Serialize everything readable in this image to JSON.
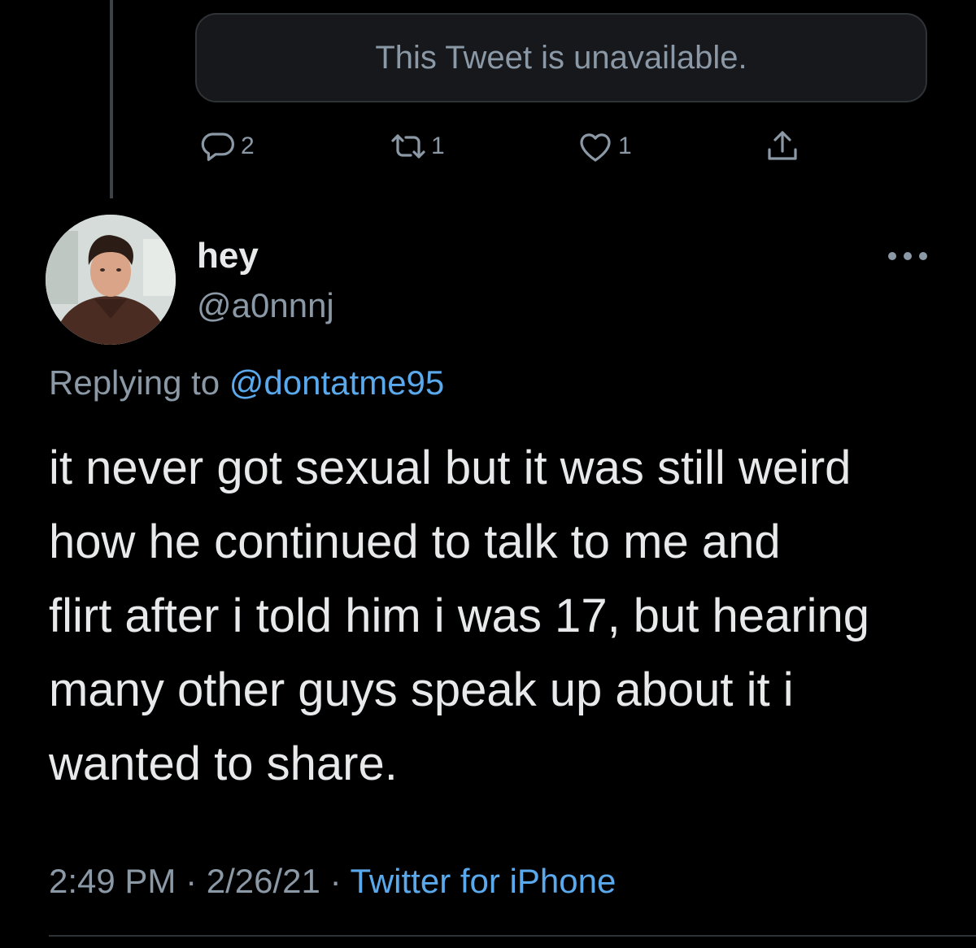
{
  "quoted": {
    "unavailable_text": "This Tweet is unavailable.",
    "actions": {
      "reply_count": "2",
      "retweet_count": "1",
      "like_count": "1"
    }
  },
  "tweet": {
    "display_name": "hey",
    "handle": "@a0nnnj",
    "replying_prefix": "Replying to",
    "replying_to": "@dontatme95",
    "text_lines": [
      "it never got sexual but it was still weird",
      "how he continued to talk to me and",
      "flirt after i told him i was 17, but hearing",
      "many other guys speak up about it i",
      "wanted to share."
    ],
    "time": "2:49 PM",
    "separator": "·",
    "date": "2/26/21",
    "source": "Twitter for iPhone"
  },
  "icons": {
    "reply": "reply-icon",
    "retweet": "retweet-icon",
    "like": "heart-icon",
    "share": "share-icon",
    "more": "more-options-icon"
  },
  "colors": {
    "background": "#000000",
    "text": "#e7e9ea",
    "secondary": "#8b98a5",
    "link": "#5aa9ec",
    "border": "#2f3336"
  }
}
